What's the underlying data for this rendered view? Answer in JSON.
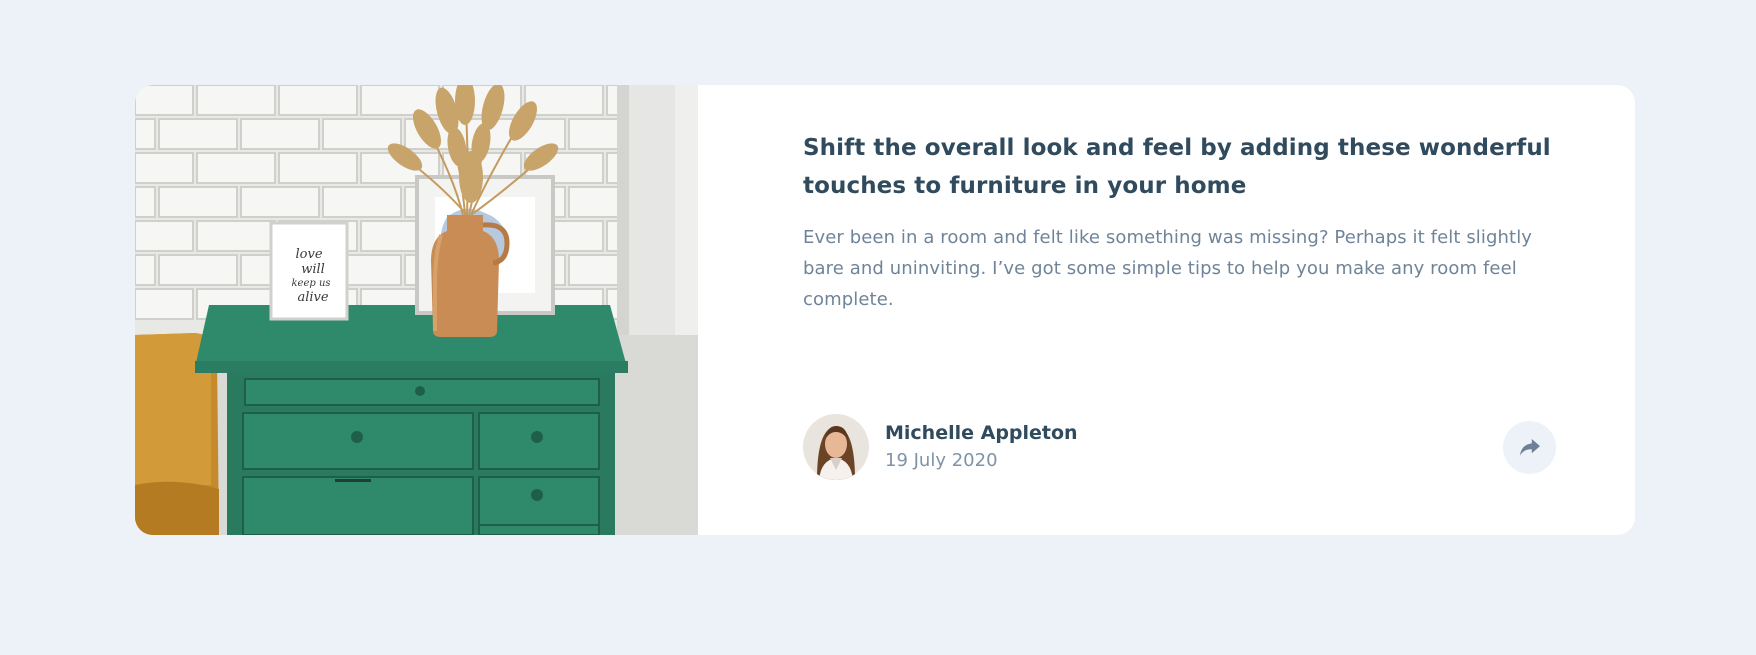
{
  "article": {
    "headline": "Shift the overall look and feel by adding these wonderful touches to furniture in your home",
    "excerpt": "Ever been in a room and felt like something was missing? Perhaps it felt slightly bare and uninviting. I’ve got some simple tips to help you make any room feel complete.",
    "image_icon": "furniture-photo",
    "image_text": {
      "line1": "love",
      "line2": "will",
      "line3": "keep us",
      "line4": "alive"
    }
  },
  "author": {
    "name": "Michelle Appleton",
    "date": "19 July 2020",
    "avatar_icon": "avatar-photo"
  },
  "share": {
    "icon": "share-icon"
  },
  "colors": {
    "page_background": "#ecf2f8",
    "card_background": "#ffffff",
    "headline": "#304a5e",
    "body_text": "#6f8499",
    "muted": "#7f93a7",
    "dresser_green": "#2d7d63"
  }
}
